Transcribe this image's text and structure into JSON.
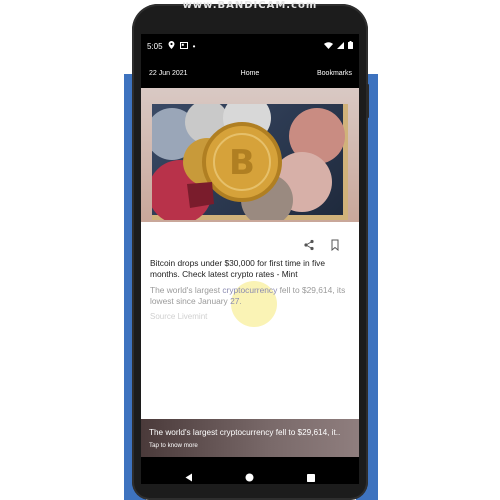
{
  "watermark": "www.BANDICAM.com",
  "status_bar": {
    "time": "5:05",
    "dot": "•",
    "icons": [
      "location-icon",
      "news-icon",
      "wifi-icon",
      "signal-icon",
      "battery-icon"
    ]
  },
  "app_bar": {
    "date": "22 Jun 2021",
    "home_label": "Home",
    "bookmarks_label": "Bookmarks"
  },
  "article": {
    "image_subject": "cryptocurrency coins",
    "headline": "Bitcoin drops under $30,000 for first time in five months. Check latest crypto rates - Mint",
    "summary_part1": "The world's largest ",
    "summary_link": "cryptocurrency",
    "summary_part2": " fell to $29,614, its lowest since January ",
    "summary_link2": "27",
    "summary_end": ".",
    "source": "Source Livemint"
  },
  "bottom_card": {
    "title": "The world's largest cryptocurrency fell to $29,614, it..",
    "subtitle": "Tap to know more"
  },
  "colors": {
    "side_band": "#3e73bf",
    "touch_highlight": "#f6ea78",
    "bitcoin_gold": "#d6a23a"
  }
}
